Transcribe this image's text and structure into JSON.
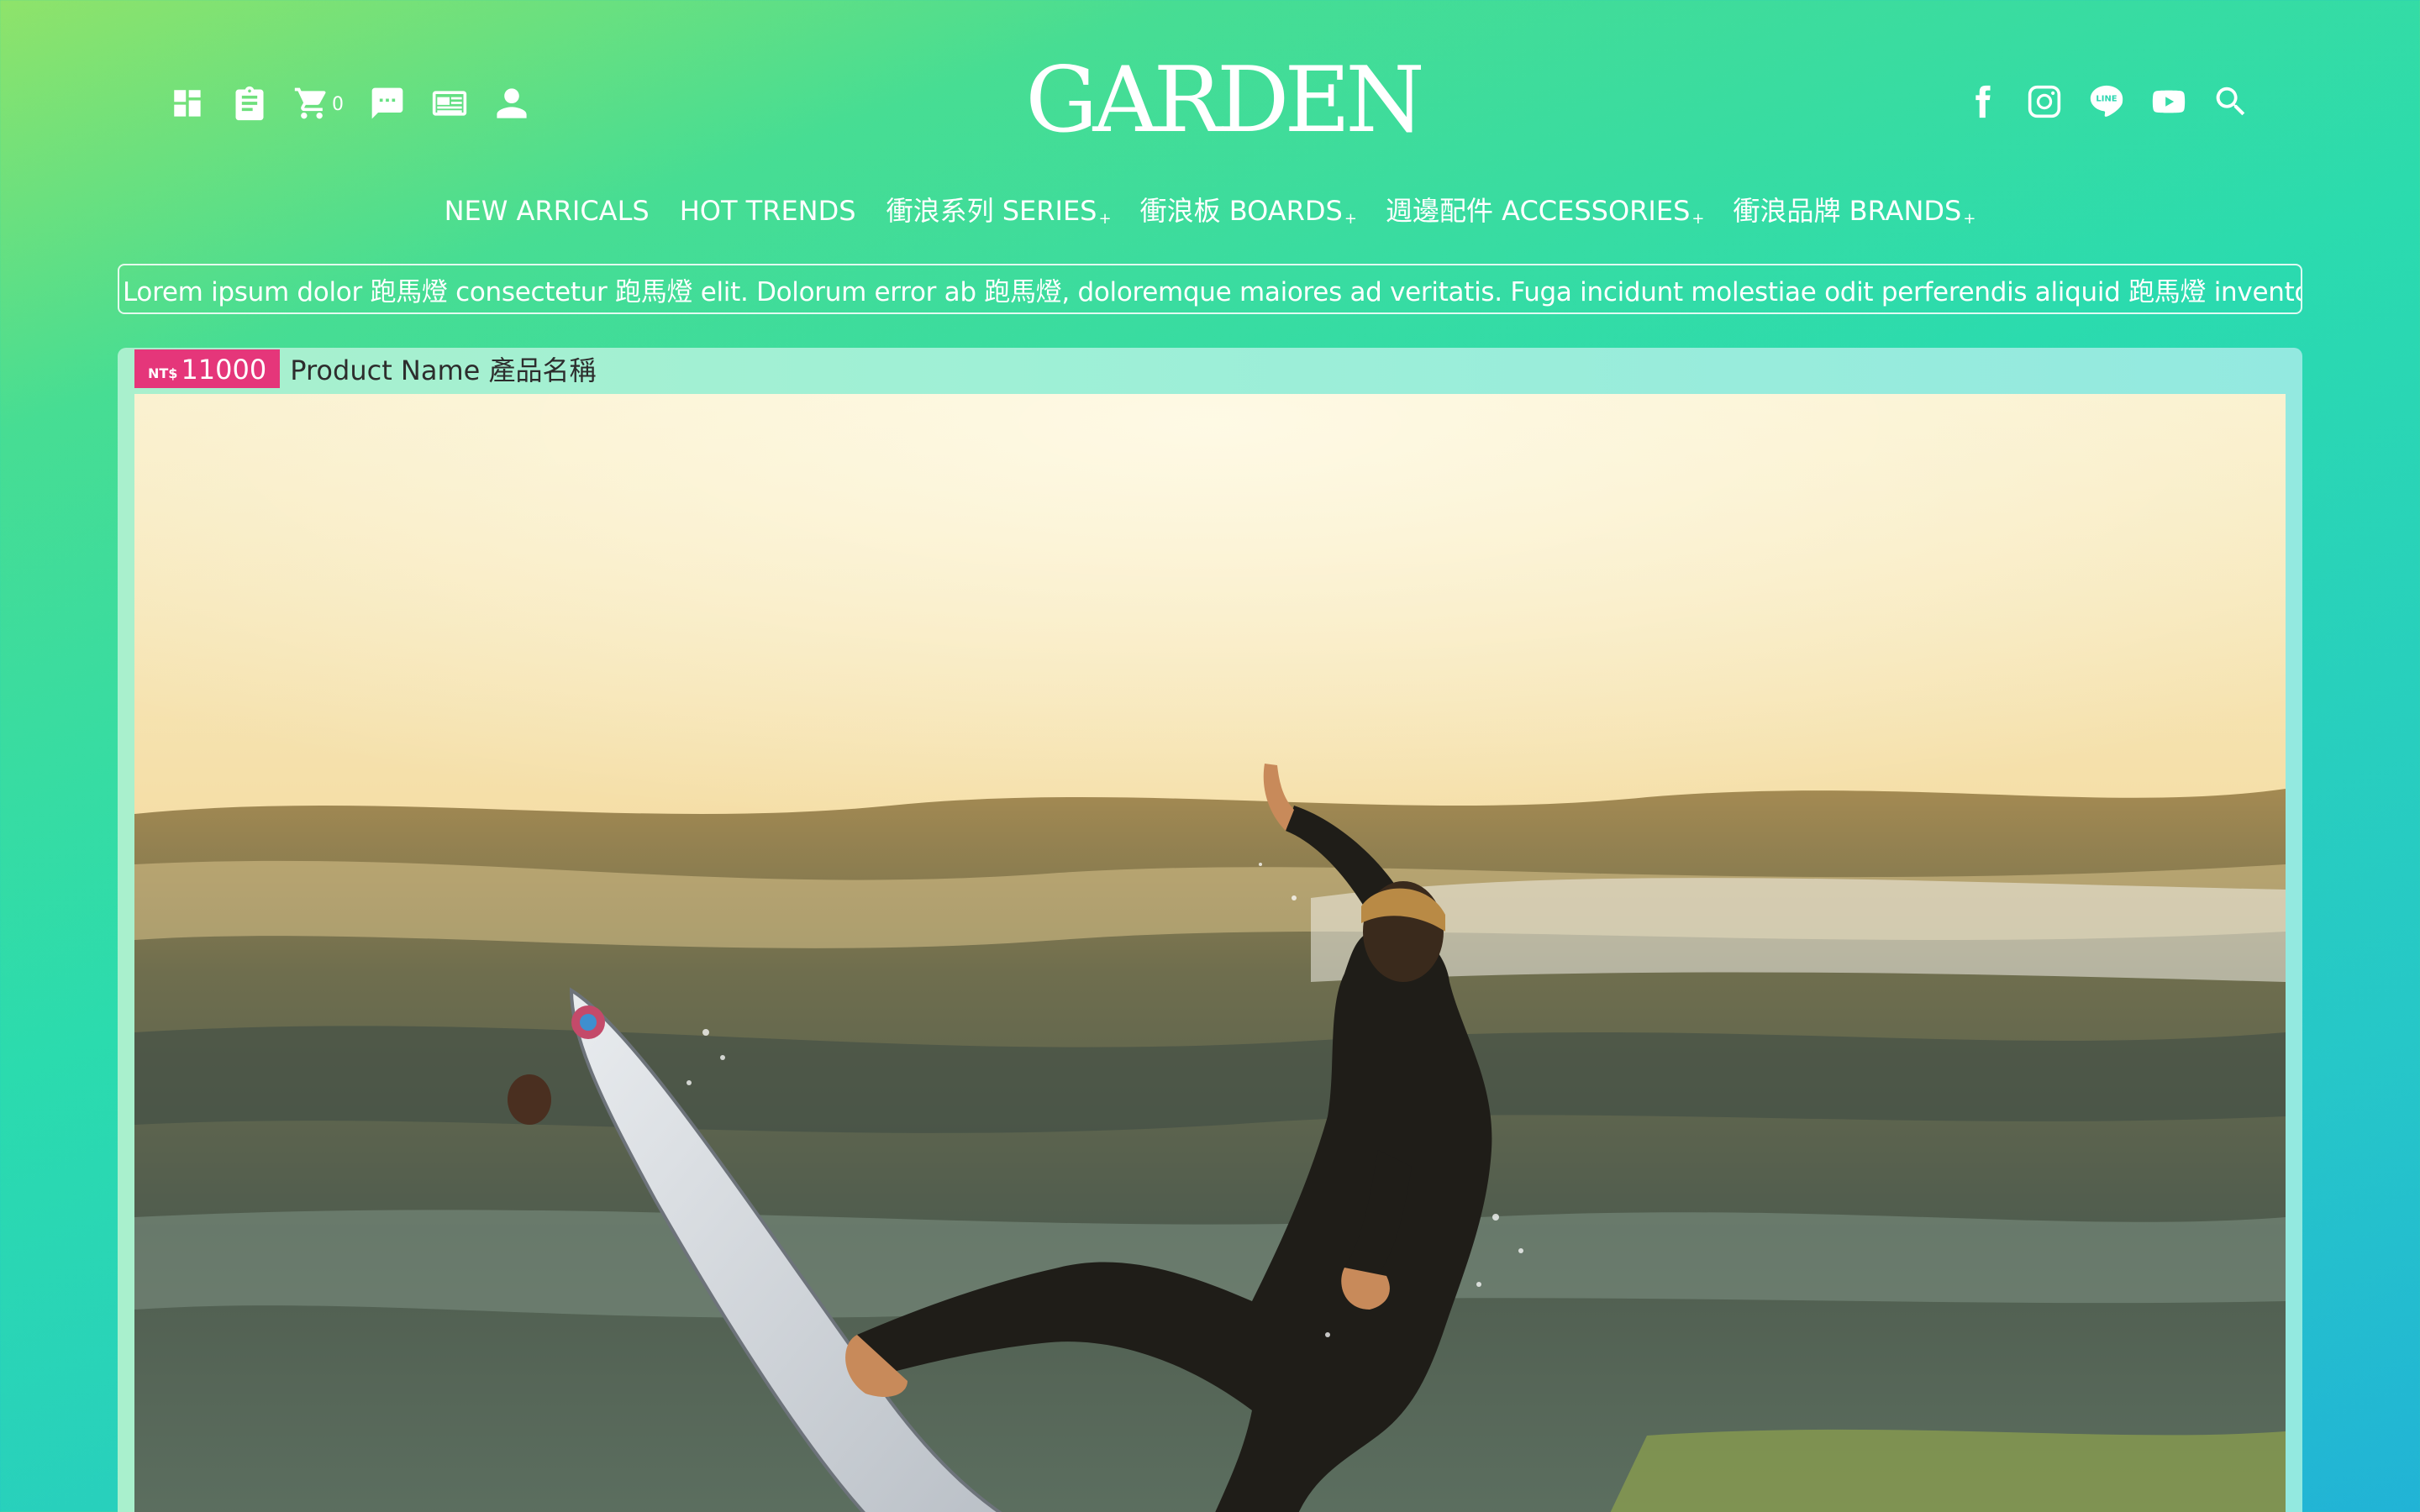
{
  "header": {
    "logo_text": "GARDEN",
    "cart_count": "0",
    "utility_icons": [
      "dashboard-icon",
      "clipboard-icon",
      "cart-icon",
      "message-icon",
      "newspaper-icon",
      "user-icon"
    ],
    "social_icons": [
      "facebook-icon",
      "instagram-icon",
      "line-icon",
      "youtube-icon",
      "search-icon"
    ],
    "line_badge_text": "LINE"
  },
  "nav": {
    "items": [
      {
        "label": "NEW ARRICALS",
        "plus": ""
      },
      {
        "label": "HOT TRENDS",
        "plus": ""
      },
      {
        "label": "衝浪系列 SERIES",
        "plus": "+"
      },
      {
        "label": "衝浪板 BOARDS",
        "plus": "+"
      },
      {
        "label": "週邊配件 ACCESSORIES",
        "plus": "+"
      },
      {
        "label": "衝浪品牌 BRANDS",
        "plus": "+"
      }
    ]
  },
  "marquee": {
    "text": "Lorem ipsum dolor 跑馬燈 consectetur 跑馬燈 elit. Dolorum error ab 跑馬燈, doloremque maiores ad veritatis. Fuga incidunt molestiae odit perferendis aliquid 跑馬燈 inventore"
  },
  "product": {
    "currency": "NT$",
    "price": "11000",
    "name": "Product Name 產品名稱",
    "image_subject": "surfer-riding-wave-photo"
  },
  "colors": {
    "price_badge": "#e5367a",
    "text_white": "#ffffff",
    "card_bg": "#9ff0d6"
  }
}
